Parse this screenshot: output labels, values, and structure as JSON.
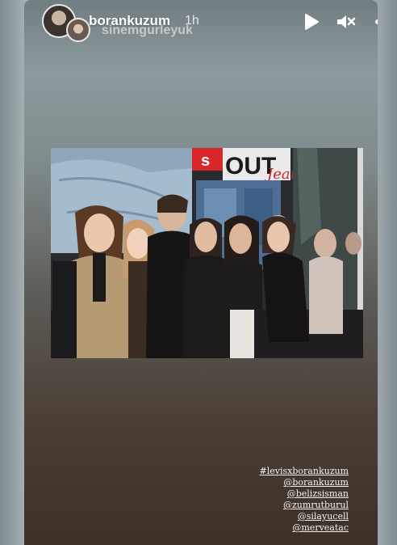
{
  "header": {
    "username": "borankuzum",
    "time": "1h",
    "secondary_user": "sinemgurleyuk"
  },
  "icons": {
    "play": "play-icon",
    "mute": "mute-icon",
    "more": "more-icon"
  },
  "photo": {
    "sign_text": "s",
    "sign_text_2": "OUT",
    "sign_script": "Jeans"
  },
  "mentions": [
    "#levisxborankuzum",
    "@borankuzum",
    "@belizsisman",
    "@zumrutburul",
    "@silayucell",
    "@merveatac"
  ]
}
